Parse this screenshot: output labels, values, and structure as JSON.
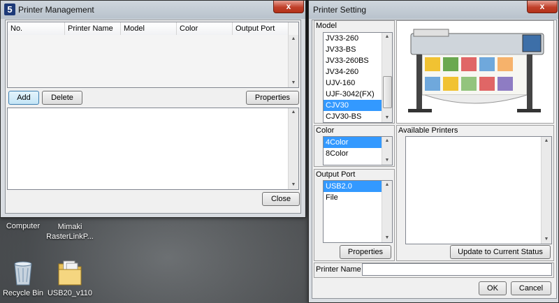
{
  "printer_management": {
    "title": "Printer Management",
    "close_glyph": "x",
    "columns": [
      "No.",
      "Printer Name",
      "Model",
      "Color",
      "Output Port"
    ],
    "add_label": "Add",
    "delete_label": "Delete",
    "properties_label": "Properties",
    "close_label": "Close"
  },
  "printer_setting": {
    "title": "Printer Setting",
    "close_glyph": "x",
    "model_label": "Model",
    "models": [
      "JV33-260",
      "JV33-BS",
      "JV33-260BS",
      "JV34-260",
      "UJV-160",
      "UJF-3042(FX)",
      "CJV30",
      "CJV30-BS"
    ],
    "selected_model": "CJV30",
    "color_label": "Color",
    "colors": [
      "4Color",
      "8Color"
    ],
    "selected_color": "4Color",
    "output_port_label": "Output Port",
    "ports": [
      "USB2.0",
      "File"
    ],
    "selected_port": "USB2.0",
    "properties_label": "Properties",
    "available_printers_label": "Available Printers",
    "update_label": "Update to Current Status",
    "printer_name_label": "Printer Name",
    "printer_name_value": "",
    "ok_label": "OK",
    "cancel_label": "Cancel"
  },
  "desktop": {
    "icons": [
      "Computer",
      "Mimaki RasterLinkP...",
      "Recycle Bin",
      "USB20_v110"
    ]
  },
  "colors": {
    "selection": "#3399ff",
    "close_button": "#c0402a"
  },
  "icons": {
    "app_icon": "number-5-app-icon"
  }
}
